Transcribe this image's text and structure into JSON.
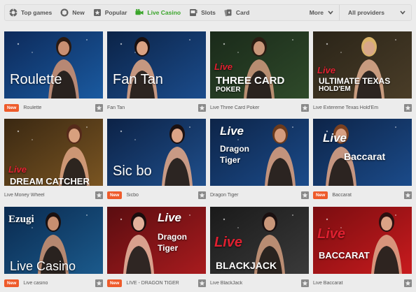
{
  "nav": {
    "items": [
      {
        "label": "Top games",
        "icon": "chip-icon"
      },
      {
        "label": "New",
        "icon": "new-icon"
      },
      {
        "label": "Popular",
        "icon": "popular-icon"
      },
      {
        "label": "Live Casino",
        "icon": "video-camera-icon",
        "active": true
      },
      {
        "label": "Slots",
        "icon": "slots-icon"
      },
      {
        "label": "Card",
        "icon": "card-icon"
      }
    ],
    "more_label": "More",
    "providers_label": "All providers"
  },
  "colors": {
    "accent_green": "#3aa52a",
    "badge_orange": "#ee5b2b"
  },
  "badge_new": "New",
  "games": [
    {
      "title": "Roulette",
      "is_new": true,
      "art": {
        "main": "Roulette"
      }
    },
    {
      "title": "Fan Tan",
      "is_new": false,
      "art": {
        "main": "Fan Tan"
      }
    },
    {
      "title": "Live Three Card Poker",
      "is_new": false,
      "art": {
        "live": "Live",
        "main": "THREE CARD",
        "sub": "POKER"
      }
    },
    {
      "title": "Live Extereme Texas Hold'Em",
      "is_new": false,
      "art": {
        "live": "Live",
        "main": "ULTIMATE TEXAS",
        "sub": "HOLD'EM"
      }
    },
    {
      "title": "Live Money Wheel",
      "is_new": false,
      "art": {
        "live": "Live",
        "main": "DREAM CATCHER"
      }
    },
    {
      "title": "Sicbo",
      "is_new": true,
      "art": {
        "main": "Sic bo"
      }
    },
    {
      "title": "Dragon Tiger",
      "is_new": false,
      "art": {
        "live": "Live",
        "main": "Dragon",
        "sub": "Tiger"
      }
    },
    {
      "title": "Baccarat",
      "is_new": true,
      "art": {
        "live": "Live",
        "main": "Baccarat"
      }
    },
    {
      "title": "Live casino",
      "is_new": true,
      "art": {
        "brand": "Ezugi",
        "main": "Live Casino"
      }
    },
    {
      "title": "LIVE - DRAGON TIGER",
      "is_new": true,
      "art": {
        "live": "Live",
        "main": "Dragon",
        "sub": "Tiger"
      }
    },
    {
      "title": "Live BlackJack",
      "is_new": false,
      "art": {
        "live": "Live",
        "main": "BLACKJACK"
      }
    },
    {
      "title": "Live Baccarat",
      "is_new": false,
      "art": {
        "live": "Live",
        "main": "BACCARAT"
      }
    }
  ]
}
